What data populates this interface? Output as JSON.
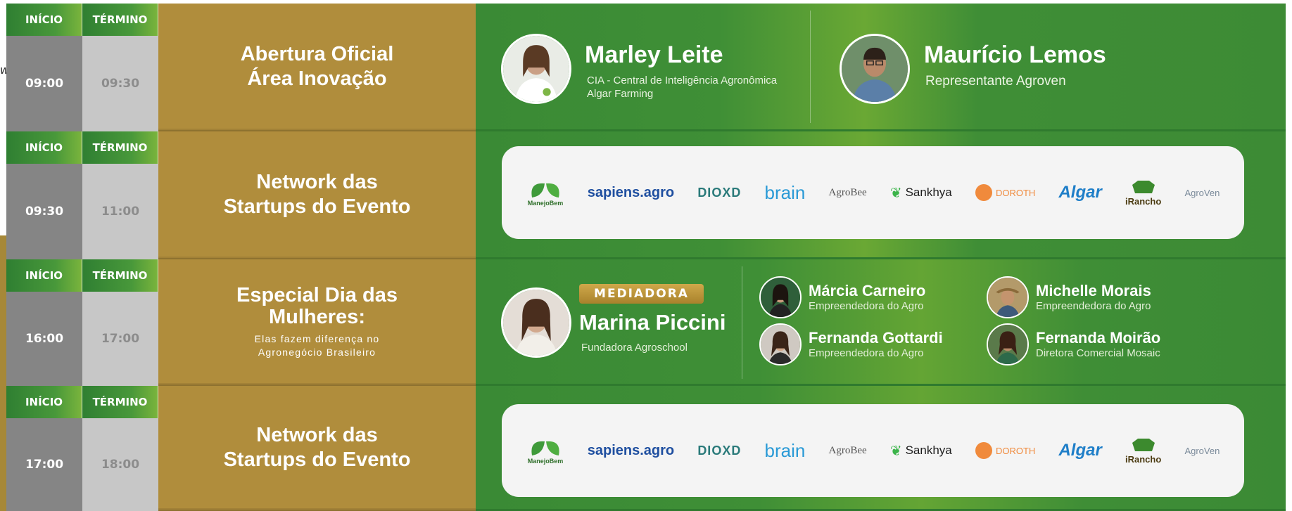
{
  "stray_text": "w",
  "schedule": [
    {
      "start_label": "INÍCIO",
      "end_label": "TÉRMINO",
      "start": "09:00",
      "end": "09:30",
      "title_lines": [
        "Abertura Oficial",
        "Área Inovação"
      ],
      "speakers": [
        {
          "name": "Marley Leite",
          "role_lines": [
            "CIA - Central de Inteligência Agronômica",
            "Algar Farming"
          ]
        },
        {
          "name": "Maurício Lemos",
          "role_lines": [
            "Representante Agroven"
          ]
        }
      ]
    },
    {
      "start_label": "INÍCIO",
      "end_label": "TÉRMINO",
      "start": "09:30",
      "end": "11:00",
      "title_lines": [
        "Network das",
        "Startups do Evento"
      ],
      "logos": [
        "ManejoBem",
        "sapiens.agro",
        "DIOXD",
        "brain",
        "AgroBee",
        "Sankhya",
        "DOROTH",
        "Algar",
        "iRancho",
        "AgroVen"
      ]
    },
    {
      "start_label": "INÍCIO",
      "end_label": "TÉRMINO",
      "start": "16:00",
      "end": "17:00",
      "title_lines": [
        "Especial Dia das",
        "Mulheres:"
      ],
      "subtitle": "Elas fazem diferença no Agronegócio Brasileiro",
      "mediator_badge": "MEDIADORA",
      "mediator": {
        "name": "Marina Piccini",
        "role": "Fundadora Agroschool"
      },
      "panelists": [
        {
          "name": "Márcia Carneiro",
          "role": "Empreendedora do Agro"
        },
        {
          "name": "Michelle Morais",
          "role": "Empreendedora do Agro"
        },
        {
          "name": "Fernanda Gottardi",
          "role": "Empreendedora do Agro"
        },
        {
          "name": "Fernanda Moirão",
          "role": "Diretora Comercial Mosaic"
        }
      ]
    },
    {
      "start_label": "INÍCIO",
      "end_label": "TÉRMINO",
      "start": "17:00",
      "end": "18:00",
      "title_lines": [
        "Network das",
        "Startups do Evento"
      ],
      "logos": [
        "ManejoBem",
        "sapiens.agro",
        "DIOXD",
        "brain",
        "AgroBee",
        "Sankhya",
        "DOROTH",
        "Algar",
        "iRancho",
        "AgroVen"
      ]
    }
  ],
  "colors": {
    "green": "#3d8c35",
    "gold": "#b08d3c",
    "grey_dark": "#858585",
    "grey_light": "#c7c7c7"
  }
}
